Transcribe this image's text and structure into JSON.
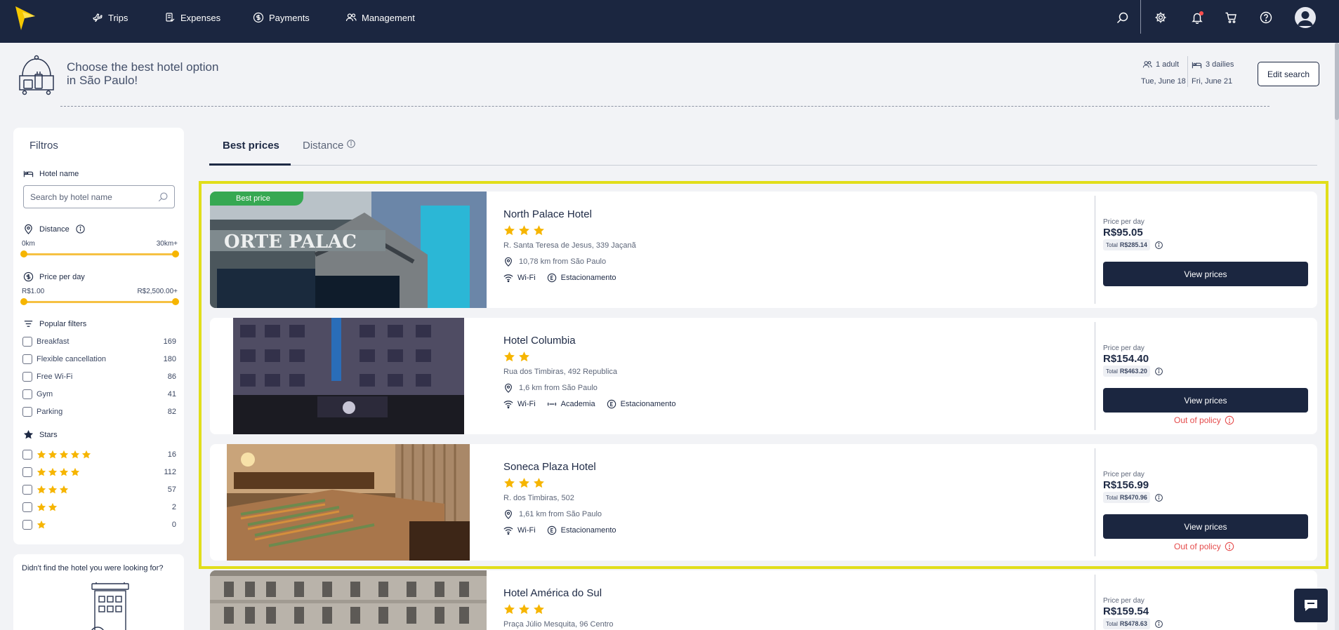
{
  "nav": {
    "items": [
      {
        "label": "Trips",
        "icon": "plane-icon"
      },
      {
        "label": "Expenses",
        "icon": "receipt-icon"
      },
      {
        "label": "Payments",
        "icon": "dollar-icon"
      },
      {
        "label": "Management",
        "icon": "users-icon"
      }
    ],
    "right_icons": [
      "search-icon",
      "gear-icon",
      "bell-icon",
      "cart-icon",
      "help-icon",
      "avatar"
    ],
    "colors": {
      "bar": "#1b2640",
      "logo": "#f6c800",
      "notification": "#ff4d4d"
    }
  },
  "header": {
    "headline_line1": "Choose the best hotel option",
    "headline_line2": "in São Paulo!",
    "guests": "1 adult",
    "dailies": "3 dailies",
    "checkin": "Tue, June 18",
    "checkout": "Fri, June 21",
    "edit_label": "Edit search"
  },
  "filters": {
    "title": "Filtros",
    "hotel_name_label": "Hotel name",
    "hotel_name_placeholder": "Search by hotel name",
    "distance_label": "Distance",
    "distance_min": "0km",
    "distance_max": "30km+",
    "price_label": "Price per day",
    "price_min": "R$1.00",
    "price_max": "R$2,500.00+",
    "popular_label": "Popular filters",
    "popular": [
      {
        "label": "Breakfast",
        "count": "169"
      },
      {
        "label": "Flexible cancellation",
        "count": "180"
      },
      {
        "label": "Free Wi-Fi",
        "count": "86"
      },
      {
        "label": "Gym",
        "count": "41"
      },
      {
        "label": "Parking",
        "count": "82"
      }
    ],
    "stars_label": "Stars",
    "stars": [
      {
        "stars": 5,
        "count": "16"
      },
      {
        "stars": 4,
        "count": "112"
      },
      {
        "stars": 3,
        "count": "57"
      },
      {
        "stars": 2,
        "count": "2"
      },
      {
        "stars": 1,
        "count": "0"
      }
    ],
    "not_found_text": "Didn't find the hotel you were looking for?"
  },
  "tabs": {
    "best": "Best prices",
    "distance": "Distance"
  },
  "hotels": [
    {
      "badge": "Best price",
      "name": "North Palace Hotel",
      "stars": 3,
      "address": "R. Santa Teresa de Jesus, 339 Jaçanã",
      "distance": "10,78 km from São Paulo",
      "amenities": [
        "Wi-Fi",
        "Estacionamento"
      ],
      "price_label": "Price per day",
      "price": "R$95.05",
      "total_label": "Total",
      "total": "R$285.14",
      "button": "View prices",
      "out_of_policy": ""
    },
    {
      "badge": "",
      "name": "Hotel Columbia",
      "stars": 2,
      "address": "Rua dos Timbiras, 492 Republica",
      "distance": "1,6 km from São Paulo",
      "amenities": [
        "Wi-Fi",
        "Academia",
        "Estacionamento"
      ],
      "price_label": "Price per day",
      "price": "R$154.40",
      "total_label": "Total",
      "total": "R$463.20",
      "button": "View prices",
      "out_of_policy": "Out of policy"
    },
    {
      "badge": "",
      "name": "Soneca Plaza Hotel",
      "stars": 3,
      "address": "R. dos Timbiras, 502",
      "distance": "1,61 km from São Paulo",
      "amenities": [
        "Wi-Fi",
        "Estacionamento"
      ],
      "price_label": "Price per day",
      "price": "R$156.99",
      "total_label": "Total",
      "total": "R$470.96",
      "button": "View prices",
      "out_of_policy": "Out of policy"
    },
    {
      "badge": "",
      "name": "Hotel América do Sul",
      "stars": 3,
      "address": "Praça Júlio Mesquita, 96 Centro",
      "distance": "",
      "amenities": [],
      "price_label": "Price per day",
      "price": "R$159.54",
      "total_label": "Total",
      "total": "R$478.63",
      "button": "",
      "out_of_policy": ""
    }
  ]
}
